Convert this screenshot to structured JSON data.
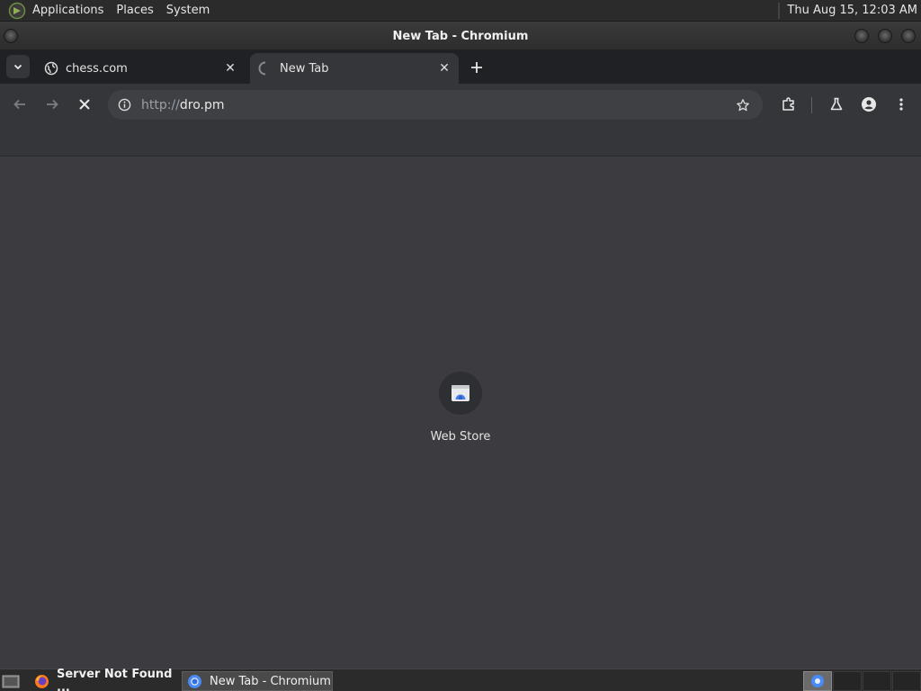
{
  "top_panel": {
    "menus": [
      "Applications",
      "Places",
      "System"
    ],
    "clock": "Thu Aug 15, 12:03 AM"
  },
  "window": {
    "title": "New Tab - Chromium"
  },
  "tabs": [
    {
      "title": "chess.com",
      "icon": "globe-icon",
      "active": false
    },
    {
      "title": "New Tab",
      "icon": "loading-spinner-icon",
      "active": true
    }
  ],
  "toolbar": {
    "url_scheme": "http://",
    "url_host": "dro.pm"
  },
  "content": {
    "shortcut_label": "Web Store"
  },
  "taskbar": {
    "items": [
      {
        "label": "Server Not Found ...",
        "icon": "firefox-icon"
      },
      {
        "label": "New Tab - Chromium",
        "icon": "chromium-icon"
      }
    ]
  },
  "colors": {
    "panel": "#2b2b2b",
    "tabstrip": "#202124",
    "toolbar": "#35363a",
    "page": "#3c3c40",
    "webstore_blue": "#4a7ee8"
  }
}
